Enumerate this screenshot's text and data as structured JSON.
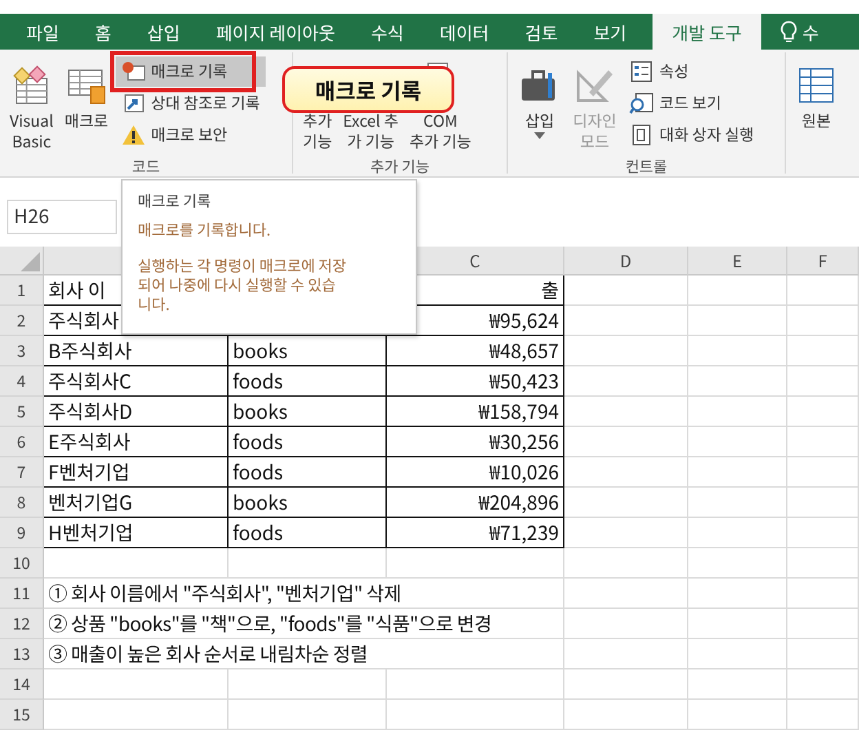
{
  "tabs": [
    {
      "label": "파일",
      "selected": false
    },
    {
      "label": "홈",
      "selected": false
    },
    {
      "label": "삽입",
      "selected": false
    },
    {
      "label": "페이지 레이아웃",
      "selected": false
    },
    {
      "label": "수식",
      "selected": false
    },
    {
      "label": "데이터",
      "selected": false
    },
    {
      "label": "검토",
      "selected": false
    },
    {
      "label": "보기",
      "selected": false
    },
    {
      "label": "개발 도구",
      "selected": true
    }
  ],
  "tell_me": "수",
  "ribbon": {
    "groups": [
      {
        "label": "코드",
        "large": [
          {
            "lines": [
              "Visual",
              "Basic"
            ],
            "disabled": false
          },
          {
            "lines": [
              "매크로"
            ],
            "disabled": false
          }
        ],
        "small": [
          {
            "label": "매크로 기록",
            "selected": true,
            "disabled": false
          },
          {
            "label": "상대 참조로 기록",
            "selected": false,
            "disabled": false
          },
          {
            "label": "매크로 보안",
            "selected": false,
            "disabled": false
          }
        ]
      },
      {
        "label": "추가 기능",
        "large": [
          {
            "lines": [
              "추가",
              "기능"
            ],
            "disabled": false
          },
          {
            "lines": [
              "Excel 추",
              "가 기능"
            ],
            "disabled": false
          },
          {
            "lines": [
              "COM",
              "추가 기능"
            ],
            "disabled": false
          }
        ]
      },
      {
        "label": "컨트롤",
        "large": [
          {
            "lines": [
              "삽입"
            ],
            "disabled": false
          },
          {
            "lines": [
              "디자인",
              "모드"
            ],
            "disabled": true
          }
        ],
        "small": [
          {
            "label": "속성",
            "selected": false,
            "disabled": false
          },
          {
            "label": "코드 보기",
            "selected": false,
            "disabled": false
          },
          {
            "label": "대화 상자 실행",
            "selected": false,
            "disabled": false
          }
        ]
      },
      {
        "large": [
          {
            "lines": [
              "원본"
            ],
            "disabled": false
          }
        ]
      }
    ]
  },
  "callout": "매크로 기록",
  "tooltip": {
    "title": "매크로 기록",
    "lines": [
      "매크로를 기록합니다.",
      "실행하는 각 명령이 매크로에 저장되어 나중에 다시 실행할 수 있습니다."
    ]
  },
  "name_box": "H26",
  "column_headers": [
    "C",
    "D",
    "E",
    "F"
  ],
  "rows": [
    {
      "number": "1",
      "a": "회사 이",
      "c": "출"
    },
    {
      "number": "2",
      "a": "주식회사",
      "c": "₩95,624"
    },
    {
      "number": "3",
      "a": "B주식회사",
      "b": "books",
      "c": "₩48,657"
    },
    {
      "number": "4",
      "a": "주식회사C",
      "b": "foods",
      "c": "₩50,423"
    },
    {
      "number": "5",
      "a": "주식회사D",
      "b": "books",
      "c": "₩158,794"
    },
    {
      "number": "6",
      "a": "E주식회사",
      "b": "foods",
      "c": "₩30,256"
    },
    {
      "number": "7",
      "a": "F벤처기업",
      "b": "foods",
      "c": "₩10,026"
    },
    {
      "number": "8",
      "a": "벤처기업G",
      "b": "books",
      "c": "₩204,896"
    },
    {
      "number": "9",
      "a": "H벤처기업",
      "b": "foods",
      "c": "₩71,239"
    },
    {
      "number": "10"
    },
    {
      "number": "11",
      "note": "① 회사 이름에서 \"주식회사\", \"벤처기업\" 삭제"
    },
    {
      "number": "12",
      "note": "② 상품 \"books\"를 \"책\"으로, \"foods\"를 \"식품\"으로 변경"
    },
    {
      "number": "13",
      "note": "③ 매출이 높은 회사 순서로 내림차순 정렬"
    },
    {
      "number": "14"
    },
    {
      "number": "15"
    }
  ]
}
